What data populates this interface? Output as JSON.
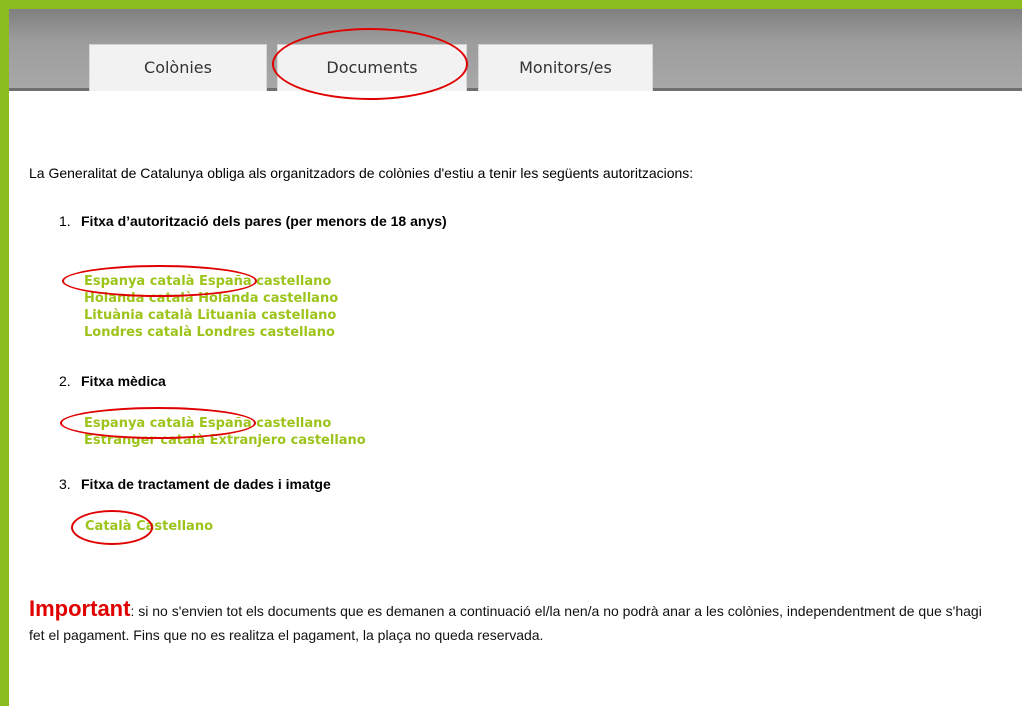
{
  "tabs": [
    {
      "label": "Colònies"
    },
    {
      "label": "Documents"
    },
    {
      "label": "Monitors/es"
    }
  ],
  "intro": "La Generalitat de Catalunya obliga als organitzadors de colònies d'estiu a tenir les següents autoritzacions:",
  "sections": [
    {
      "number": "1.",
      "title": "Fitxa d’autorització dels pares (per menors de 18 anys)",
      "rows": [
        {
          "ca": "Espanya català",
          "es": "España castellano"
        },
        {
          "ca": "Holanda català",
          "es": "Holanda castellano"
        },
        {
          "ca": "Lituània català",
          "es": "Lituania castellano"
        },
        {
          "ca": "Londres català",
          "es": "Londres castellano"
        }
      ]
    },
    {
      "number": "2.",
      "title": "Fitxa mèdica",
      "rows": [
        {
          "ca": "Espanya català",
          "es": "España castellano"
        },
        {
          "ca": "Estranger català",
          "es": "Extranjero castellano"
        }
      ]
    },
    {
      "number": "3.",
      "title": "Fitxa de tractament de dades i imatge",
      "rows": [
        {
          "ca": "Català",
          "es": "Castellano"
        }
      ]
    }
  ],
  "important": {
    "label": "Important",
    "text": ": si no s'envien tot els documents que es demanen a continuació el/la nen/a no podrà anar a les colònies, independentment de que s'hagi fet el pagament. Fins que no es realitza el pagament, la plaça no queda reservada."
  },
  "colors": {
    "accent": "#8cbd1e",
    "link": "#9cc41a",
    "annotation": "#e00000"
  }
}
